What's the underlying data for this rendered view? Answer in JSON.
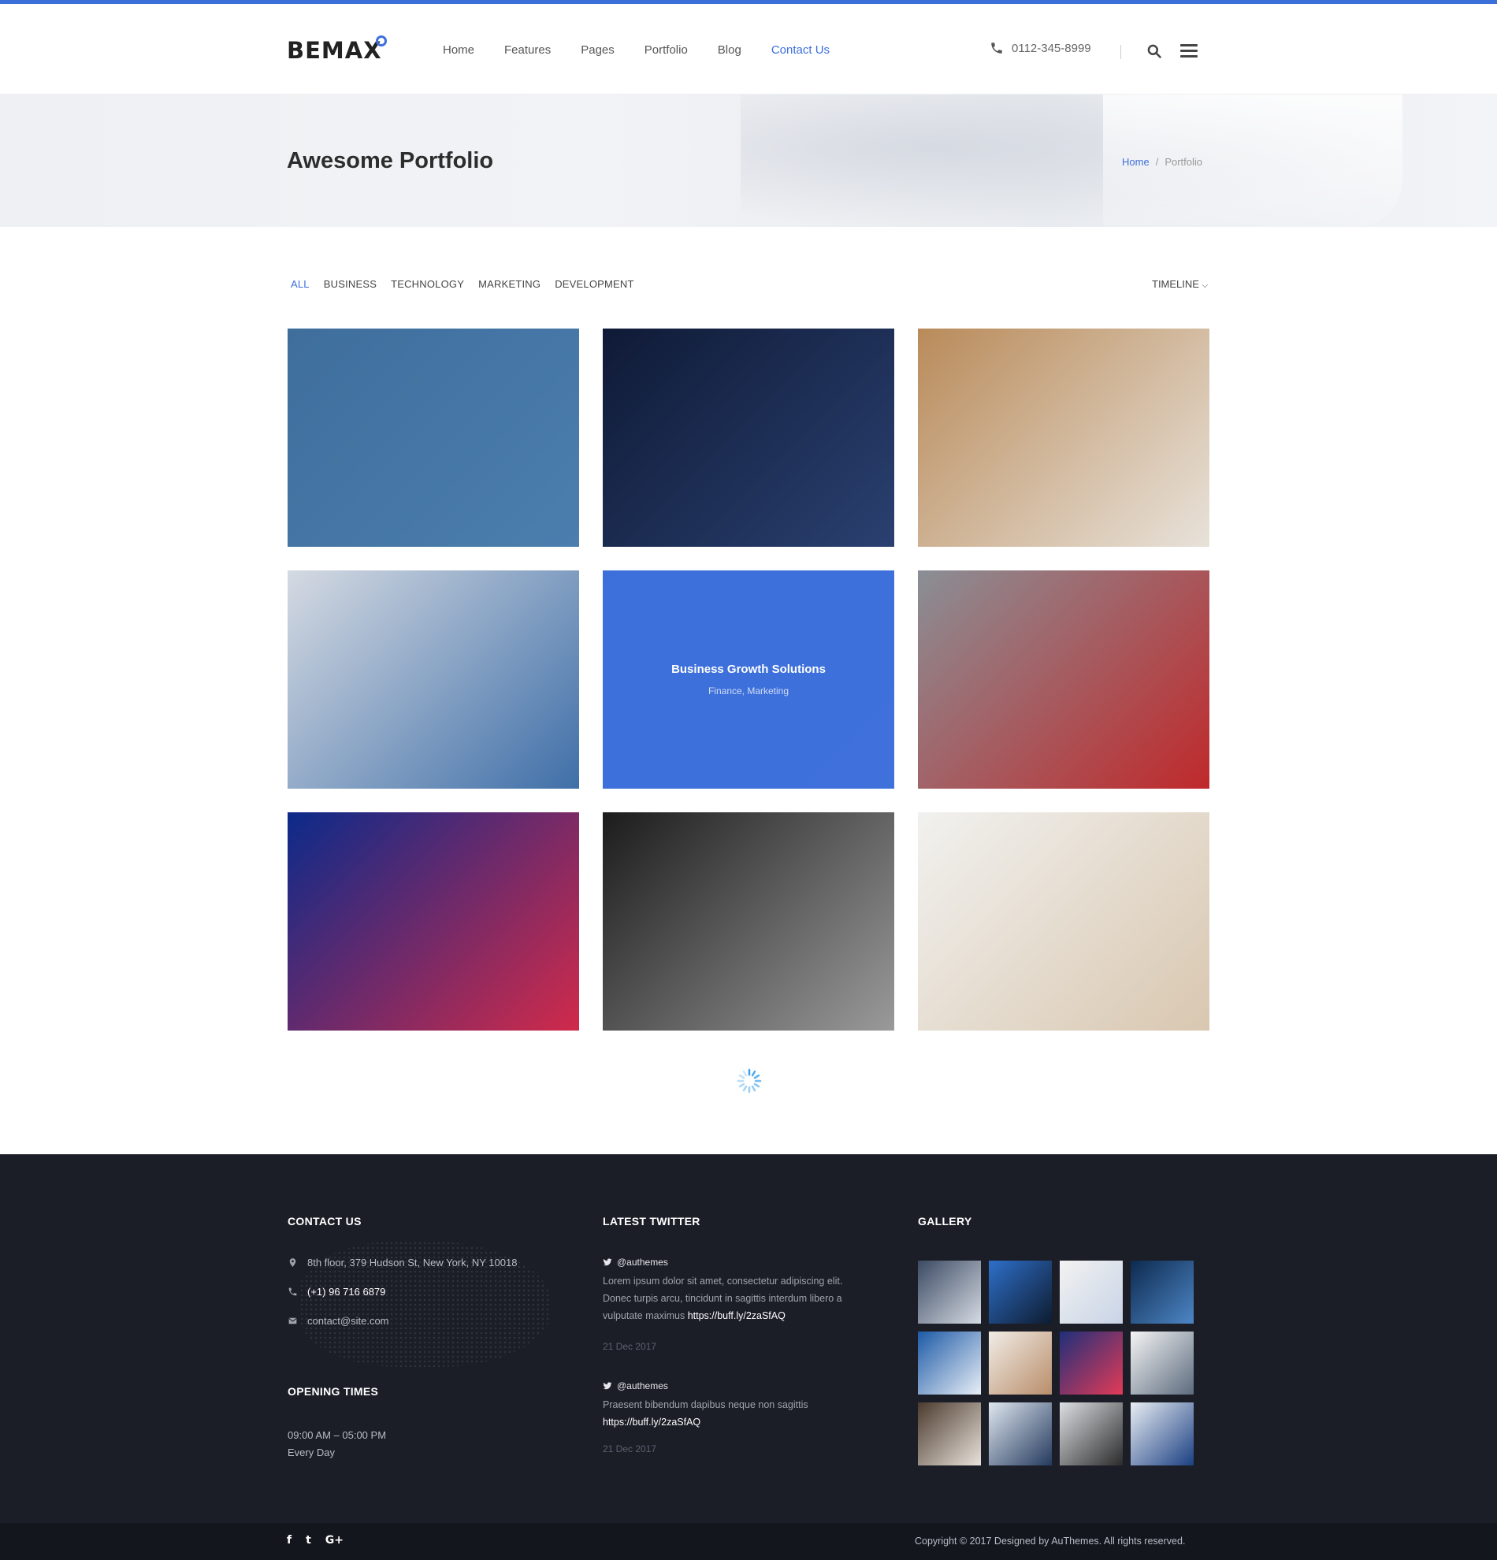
{
  "header": {
    "logo": "BEMAX",
    "nav": [
      "Home",
      "Features",
      "Pages",
      "Portfolio",
      "Blog",
      "Contact Us"
    ],
    "active_nav": "Contact Us",
    "phone": "0112-345-8999"
  },
  "banner": {
    "title": "Awesome Portfolio",
    "breadcrumb": [
      "Home",
      "/",
      "Portfolio"
    ]
  },
  "filters": {
    "items": [
      "ALL",
      "BUSINESS",
      "TECHNOLOGY",
      "MARKETING",
      "DEVELOPMENT"
    ],
    "active": "ALL",
    "sort_label": "TIMELINE"
  },
  "portfolio": {
    "featured_title": "Business Growth Solutions",
    "featured_categories": "Finance, Marketing",
    "tiles": [
      {
        "name": "security-laptop-world-map",
        "colors": [
          "#3f6e9c",
          "#4b7eae"
        ]
      },
      {
        "name": "digital-world-map",
        "colors": [
          "#0f1a36",
          "#2a4070"
        ]
      },
      {
        "name": "smiling-woman-laptop",
        "colors": [
          "#b98b5a",
          "#e8e2da"
        ]
      },
      {
        "name": "businessman-city-double-exposure",
        "colors": [
          "#d5dae2",
          "#3f6fa8"
        ]
      },
      {
        "name": "business-growth-solutions",
        "colors": [
          "#3d6fdb",
          "#4a78d8"
        ]
      },
      {
        "name": "superhero-businessman",
        "colors": [
          "#8a8f96",
          "#c0292b"
        ]
      },
      {
        "name": "stock-chart-screen",
        "colors": [
          "#0b2a8a",
          "#d12a4a"
        ]
      },
      {
        "name": "chess-pieces",
        "colors": [
          "#1c1c1c",
          "#9a9a9a"
        ]
      },
      {
        "name": "happy-couple-laptop",
        "colors": [
          "#f1f1ef",
          "#d9c7b0"
        ]
      }
    ]
  },
  "footer": {
    "contact": {
      "heading": "CONTACT US",
      "address": "8th floor, 379 Hudson St, New York, NY 10018",
      "phone": "(+1) 96 716 6879",
      "email": "contact@site.com"
    },
    "opening": {
      "heading": "OPENING TIMES",
      "hours": "09:00 AM – 05:00 PM",
      "days": "Every Day"
    },
    "twitter": {
      "heading": "LATEST TWITTER",
      "tweets": [
        {
          "handle": "@authemes",
          "text": "Lorem ipsum dolor sit amet, consectetur adipiscing elit. Donec turpis arcu, tincidunt in sagittis interdum libero a vulputate maximus",
          "link": "https://buff.ly/2zaSfAQ",
          "date": "21 Dec 2017"
        },
        {
          "handle": "@authemes",
          "text": "Praesent bibendum dapibus neque non sagittis",
          "link": "https://buff.ly/2zaSfAQ",
          "date": "21 Dec 2017"
        }
      ]
    },
    "gallery": {
      "heading": "GALLERY",
      "thumbs": [
        {
          "colors": [
            "#3b4a63",
            "#d6dbe3"
          ]
        },
        {
          "colors": [
            "#2e6fc9",
            "#0e1c30"
          ]
        },
        {
          "colors": [
            "#f2f2f2",
            "#c8d4e6"
          ]
        },
        {
          "colors": [
            "#0d2a4f",
            "#4d86c5"
          ]
        },
        {
          "colors": [
            "#1d5aa6",
            "#e8eef6"
          ]
        },
        {
          "colors": [
            "#f1ece6",
            "#b98e6b"
          ]
        },
        {
          "colors": [
            "#1f2f7a",
            "#e23b57"
          ]
        },
        {
          "colors": [
            "#f4f4f4",
            "#5c6b7e"
          ]
        },
        {
          "colors": [
            "#4b3b2e",
            "#e9e2db"
          ]
        },
        {
          "colors": [
            "#dfe6ef",
            "#243a5e"
          ]
        },
        {
          "colors": [
            "#dcdfe3",
            "#2b2b2b"
          ]
        },
        {
          "colors": [
            "#e8edf3",
            "#1b3f82"
          ]
        }
      ]
    }
  },
  "bottom": {
    "social": [
      "f",
      "t",
      "G+"
    ],
    "copyright": "Copyright © 2017 Designed by AuThemes. All rights reserved."
  },
  "colors": {
    "accent": "#3d6fdb",
    "footer_bg": "#1b1e27",
    "bottom_bg": "#14161d"
  }
}
